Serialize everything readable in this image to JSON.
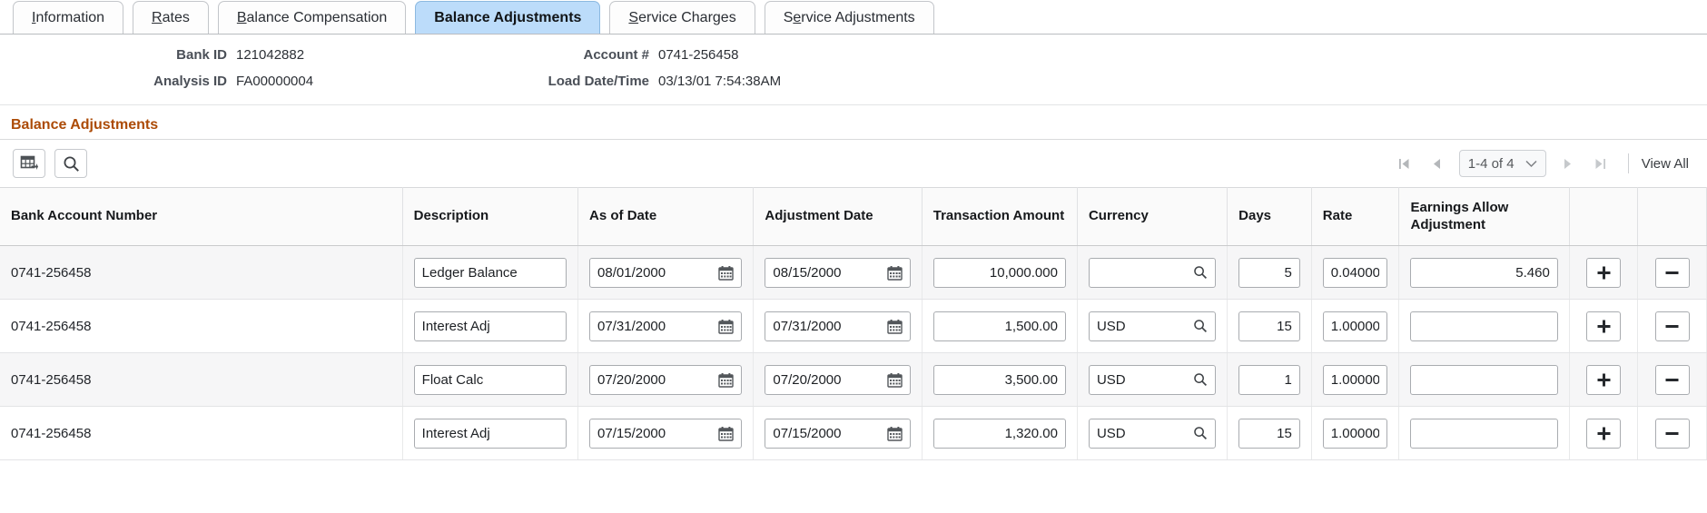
{
  "tabs": [
    {
      "label": "Information",
      "accel": "I",
      "active": false
    },
    {
      "label": "Rates",
      "accel": "R",
      "active": false
    },
    {
      "label": "Balance Compensation",
      "accel": "B",
      "active": false
    },
    {
      "label": "Balance Adjustments",
      "accel": "",
      "active": true
    },
    {
      "label": "Service Charges",
      "accel": "S",
      "active": false
    },
    {
      "label": "Service Adjustments",
      "accel": "e",
      "active": false
    }
  ],
  "header": {
    "bank_id_label": "Bank ID",
    "bank_id_value": "121042882",
    "analysis_id_label": "Analysis ID",
    "analysis_id_value": "FA00000004",
    "account_label": "Account #",
    "account_value": "0741-256458",
    "load_label": "Load Date/Time",
    "load_value": "03/13/01  7:54:38AM"
  },
  "section": {
    "title": "Balance Adjustments",
    "title_color": "#ac4b07"
  },
  "toolbar": {
    "personalize_icon": "grid-personalize-icon",
    "find_icon": "search-icon",
    "first_icon": "first-page-icon",
    "prev_icon": "previous-page-icon",
    "next_icon": "next-page-icon",
    "last_icon": "last-page-icon",
    "page_range": "1-4 of 4",
    "view_all": "View All"
  },
  "table": {
    "columns": [
      "Bank Account Number",
      "Description",
      "As of Date",
      "Adjustment Date",
      "Transaction Amount",
      "Currency",
      "Days",
      "Rate",
      "Earnings Allow Adjustment",
      "",
      ""
    ],
    "add_label": "+",
    "remove_label": "−",
    "rows": [
      {
        "bank_account_number": "0741-256458",
        "description": "Ledger Balance",
        "as_of_date": "08/01/2000",
        "adjustment_date": "08/15/2000",
        "transaction_amount": "10,000.000",
        "currency": "",
        "days": "5",
        "rate": "0.04000",
        "earnings_allow_adjustment": "5.460"
      },
      {
        "bank_account_number": "0741-256458",
        "description": "Interest Adj",
        "as_of_date": "07/31/2000",
        "adjustment_date": "07/31/2000",
        "transaction_amount": "1,500.00",
        "currency": "USD",
        "days": "15",
        "rate": "1.00000",
        "earnings_allow_adjustment": ""
      },
      {
        "bank_account_number": "0741-256458",
        "description": "Float Calc",
        "as_of_date": "07/20/2000",
        "adjustment_date": "07/20/2000",
        "transaction_amount": "3,500.00",
        "currency": "USD",
        "days": "1",
        "rate": "1.00000",
        "earnings_allow_adjustment": ""
      },
      {
        "bank_account_number": "0741-256458",
        "description": "Interest Adj",
        "as_of_date": "07/15/2000",
        "adjustment_date": "07/15/2000",
        "transaction_amount": "1,320.00",
        "currency": "USD",
        "days": "15",
        "rate": "1.00000",
        "earnings_allow_adjustment": ""
      }
    ]
  }
}
